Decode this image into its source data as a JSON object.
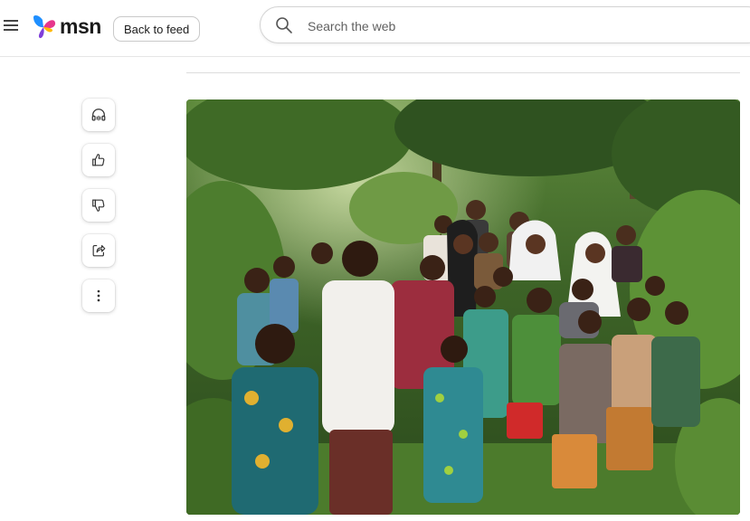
{
  "header": {
    "logo_text": "msn",
    "back_label": "Back to feed",
    "search_placeholder": "Search the web"
  },
  "actions": {
    "items": [
      {
        "name": "listen",
        "icon": "headphones-icon"
      },
      {
        "name": "like",
        "icon": "thumbs-up-icon"
      },
      {
        "name": "dislike",
        "icon": "thumbs-down-icon"
      },
      {
        "name": "share",
        "icon": "share-icon"
      },
      {
        "name": "more",
        "icon": "more-vertical-icon"
      }
    ]
  },
  "article": {
    "image": "photo of a large group of children and women standing in front of dense green forest"
  },
  "colors": {
    "logo_blue": "#1f8fff",
    "logo_pink": "#e6368c",
    "logo_purple": "#7f3fd9",
    "logo_yellow": "#ffb900"
  }
}
